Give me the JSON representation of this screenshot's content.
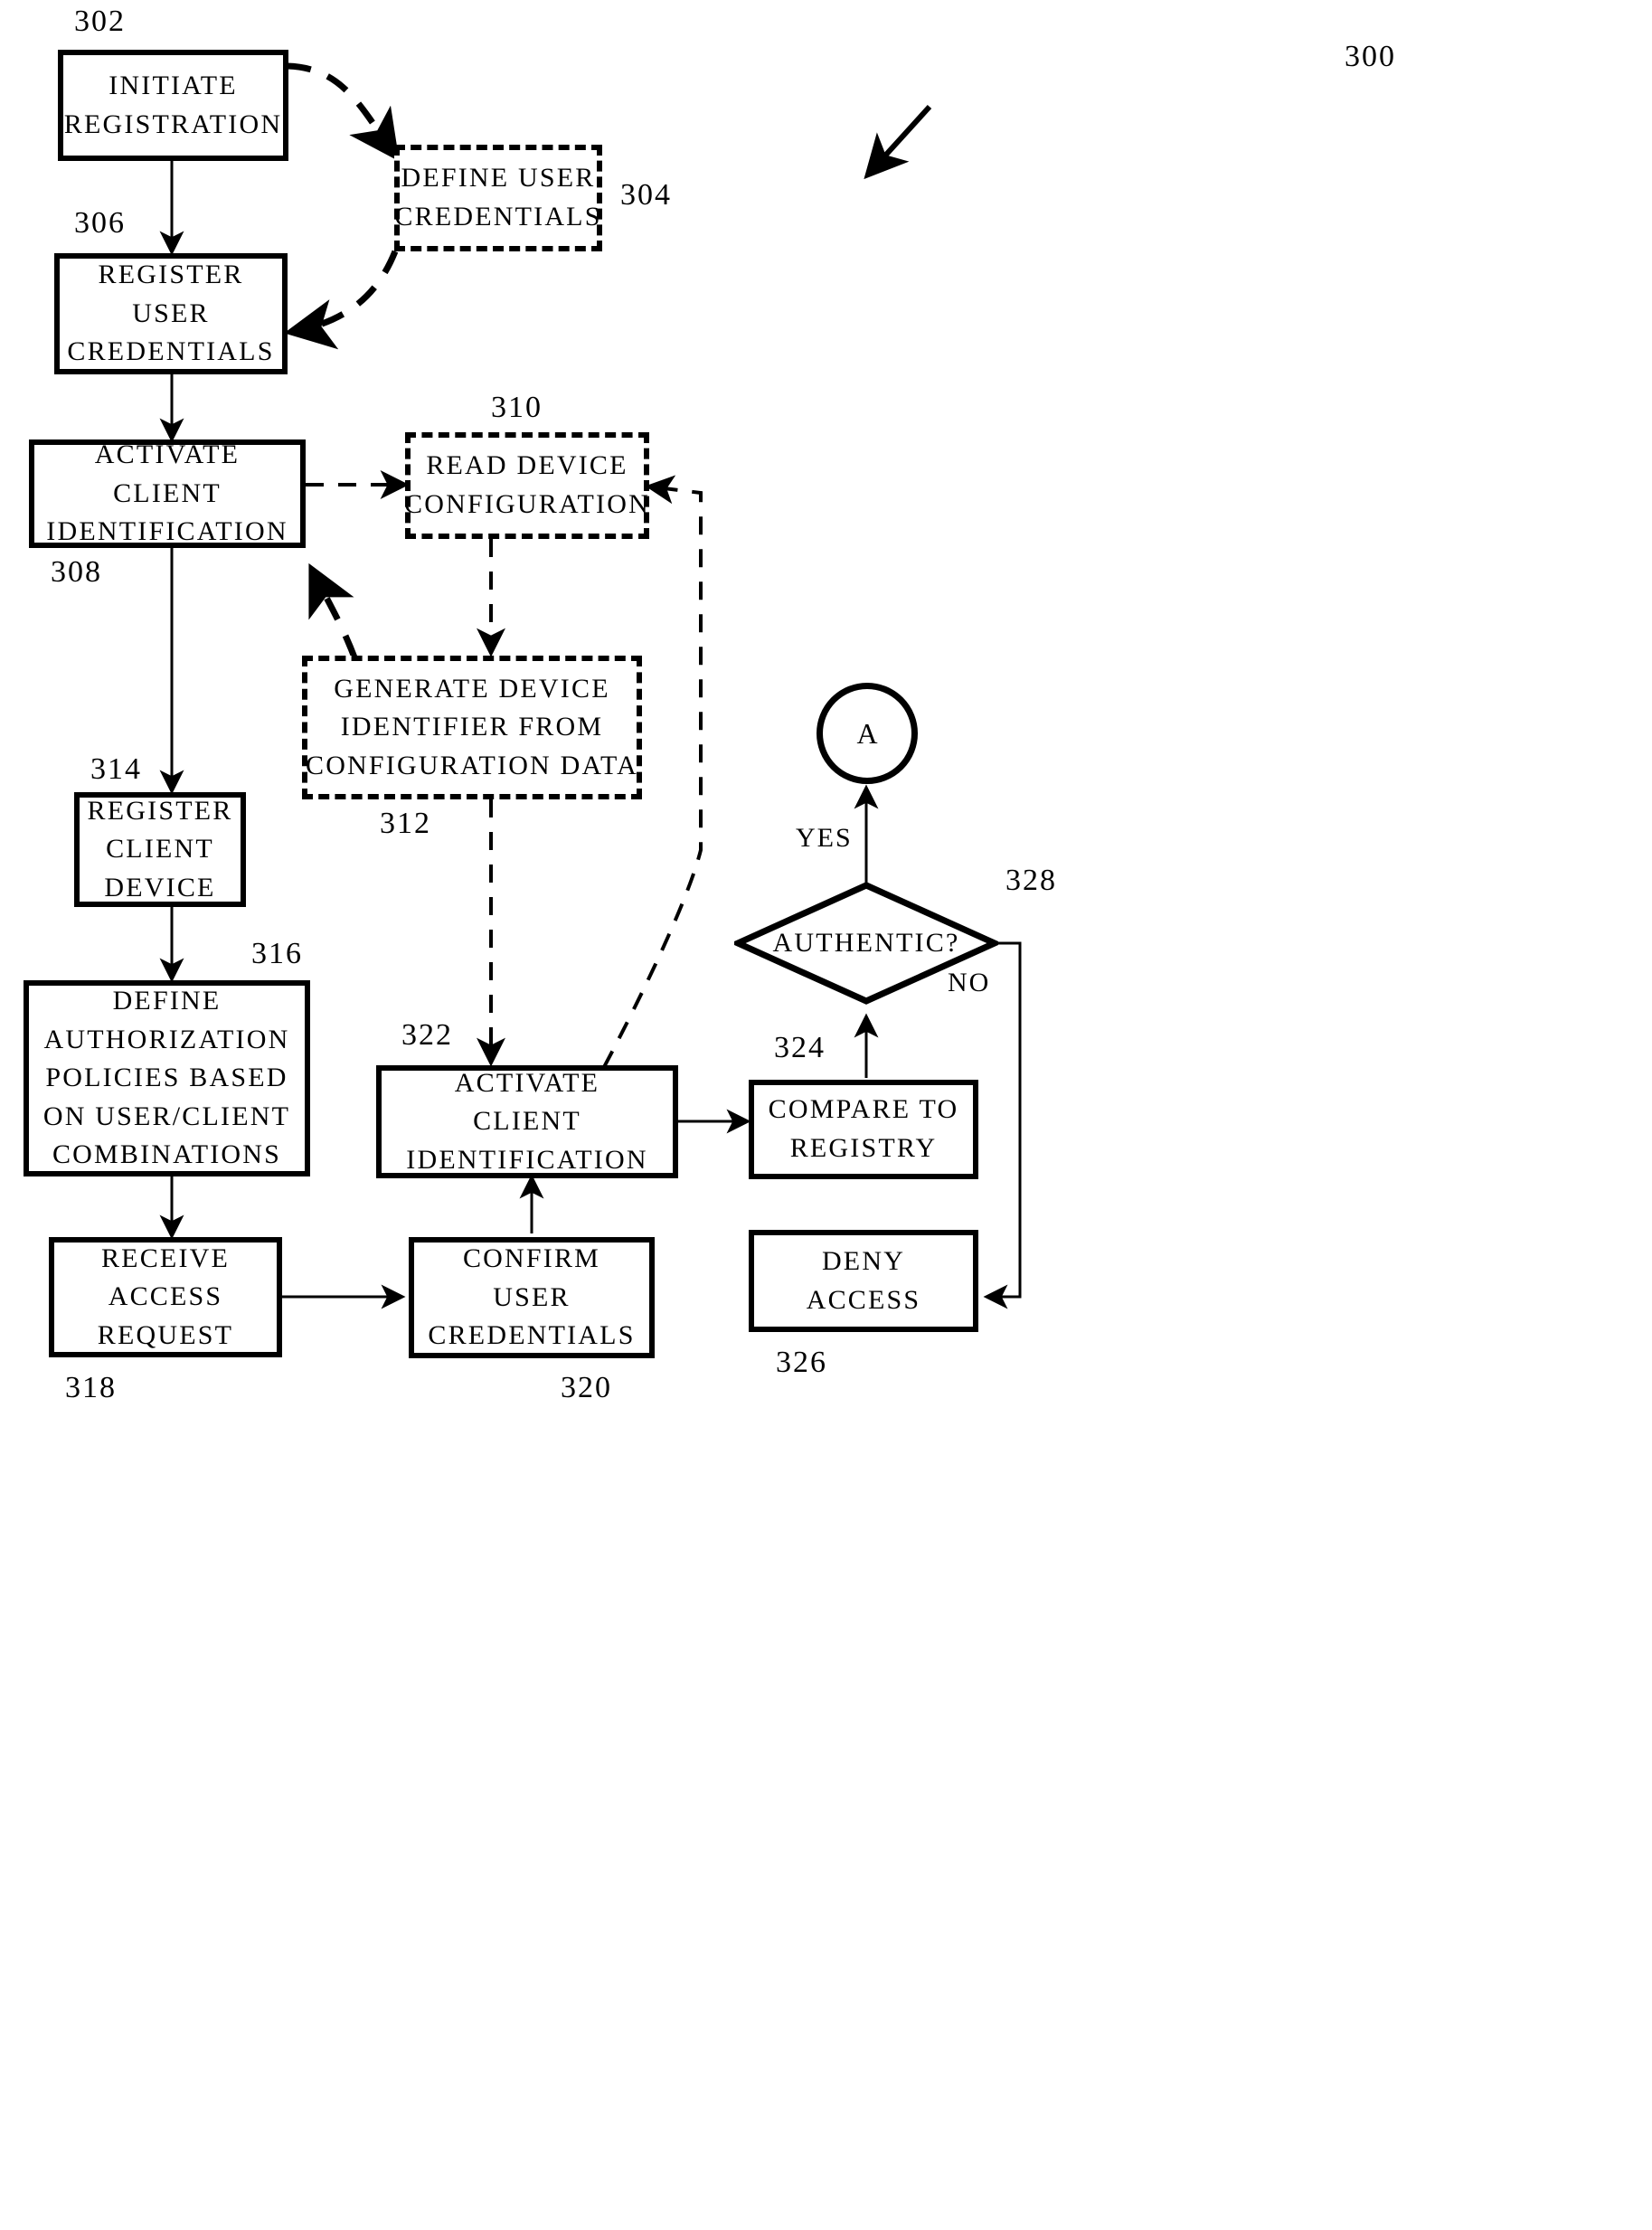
{
  "figure": {
    "id": "300",
    "type": "patent-flowchart",
    "title": "User and client device registration and authentication flow"
  },
  "nodes": [
    {
      "ref": "302",
      "style": "solid",
      "lines": [
        "INITIATE",
        "REGISTRATION"
      ]
    },
    {
      "ref": "304",
      "style": "dashed",
      "lines": [
        "DEFINE USER",
        "CREDENTIALS"
      ]
    },
    {
      "ref": "306",
      "style": "solid",
      "lines": [
        "REGISTER",
        "USER",
        "CREDENTIALS"
      ]
    },
    {
      "ref": "308",
      "style": "solid",
      "lines": [
        "ACTIVATE",
        "CLIENT",
        "IDENTIFICATION"
      ]
    },
    {
      "ref": "310",
      "style": "dashed",
      "lines": [
        "READ DEVICE",
        "CONFIGURATION"
      ]
    },
    {
      "ref": "312",
      "style": "dashed",
      "lines": [
        "GENERATE DEVICE",
        "IDENTIFIER FROM",
        "CONFIGURATION DATA"
      ]
    },
    {
      "ref": "314",
      "style": "solid",
      "lines": [
        "REGISTER",
        "CLIENT",
        "DEVICE"
      ]
    },
    {
      "ref": "316",
      "style": "solid",
      "lines": [
        "DEFINE",
        "AUTHORIZATION",
        "POLICIES BASED",
        "ON USER/CLIENT",
        "COMBINATIONS"
      ]
    },
    {
      "ref": "318",
      "style": "solid",
      "lines": [
        "RECEIVE",
        "ACCESS",
        "REQUEST"
      ]
    },
    {
      "ref": "320",
      "style": "solid",
      "lines": [
        "CONFIRM",
        "USER",
        "CREDENTIALS"
      ]
    },
    {
      "ref": "322",
      "style": "solid",
      "lines": [
        "ACTIVATE",
        "CLIENT",
        "IDENTIFICATION"
      ]
    },
    {
      "ref": "324",
      "style": "solid",
      "lines": [
        "COMPARE TO",
        "REGISTRY"
      ]
    },
    {
      "ref": "326",
      "style": "solid",
      "lines": [
        "DENY",
        "ACCESS"
      ]
    },
    {
      "ref": "328",
      "style": "diamond",
      "lines": [
        "AUTHENTIC?"
      ]
    }
  ],
  "connector": {
    "label": "A"
  },
  "edge_labels": {
    "yes": "YES",
    "no": "NO"
  },
  "refs": {
    "n300": "300",
    "n302": "302",
    "n304": "304",
    "n306": "306",
    "n308": "308",
    "n310": "310",
    "n312": "312",
    "n314": "314",
    "n316": "316",
    "n318": "318",
    "n320": "320",
    "n322": "322",
    "n324": "324",
    "n326": "326",
    "n328": "328"
  },
  "node_text": {
    "n302_l1": "INITIATE",
    "n302_l2": "REGISTRATION",
    "n304_l1": "DEFINE USER",
    "n304_l2": "CREDENTIALS",
    "n306_l1": "REGISTER",
    "n306_l2": "USER",
    "n306_l3": "CREDENTIALS",
    "n308_l1": "ACTIVATE",
    "n308_l2": "CLIENT",
    "n308_l3": "IDENTIFICATION",
    "n310_l1": "READ DEVICE",
    "n310_l2": "CONFIGURATION",
    "n312_l1": "GENERATE DEVICE",
    "n312_l2": "IDENTIFIER FROM",
    "n312_l3": "CONFIGURATION DATA",
    "n314_l1": "REGISTER",
    "n314_l2": "CLIENT",
    "n314_l3": "DEVICE",
    "n316_l1": "DEFINE",
    "n316_l2": "AUTHORIZATION",
    "n316_l3": "POLICIES BASED",
    "n316_l4": "ON USER/CLIENT",
    "n316_l5": "COMBINATIONS",
    "n318_l1": "RECEIVE",
    "n318_l2": "ACCESS",
    "n318_l3": "REQUEST",
    "n320_l1": "CONFIRM",
    "n320_l2": "USER",
    "n320_l3": "CREDENTIALS",
    "n322_l1": "ACTIVATE",
    "n322_l2": "CLIENT",
    "n322_l3": "IDENTIFICATION",
    "n324_l1": "COMPARE TO",
    "n324_l2": "REGISTRY",
    "n326_l1": "DENY",
    "n326_l2": "ACCESS",
    "n328_l1": "AUTHENTIC?",
    "circleA": "A",
    "yes": "YES",
    "no": "NO"
  },
  "colors": {
    "ink": "#000000",
    "paper": "#ffffff"
  }
}
